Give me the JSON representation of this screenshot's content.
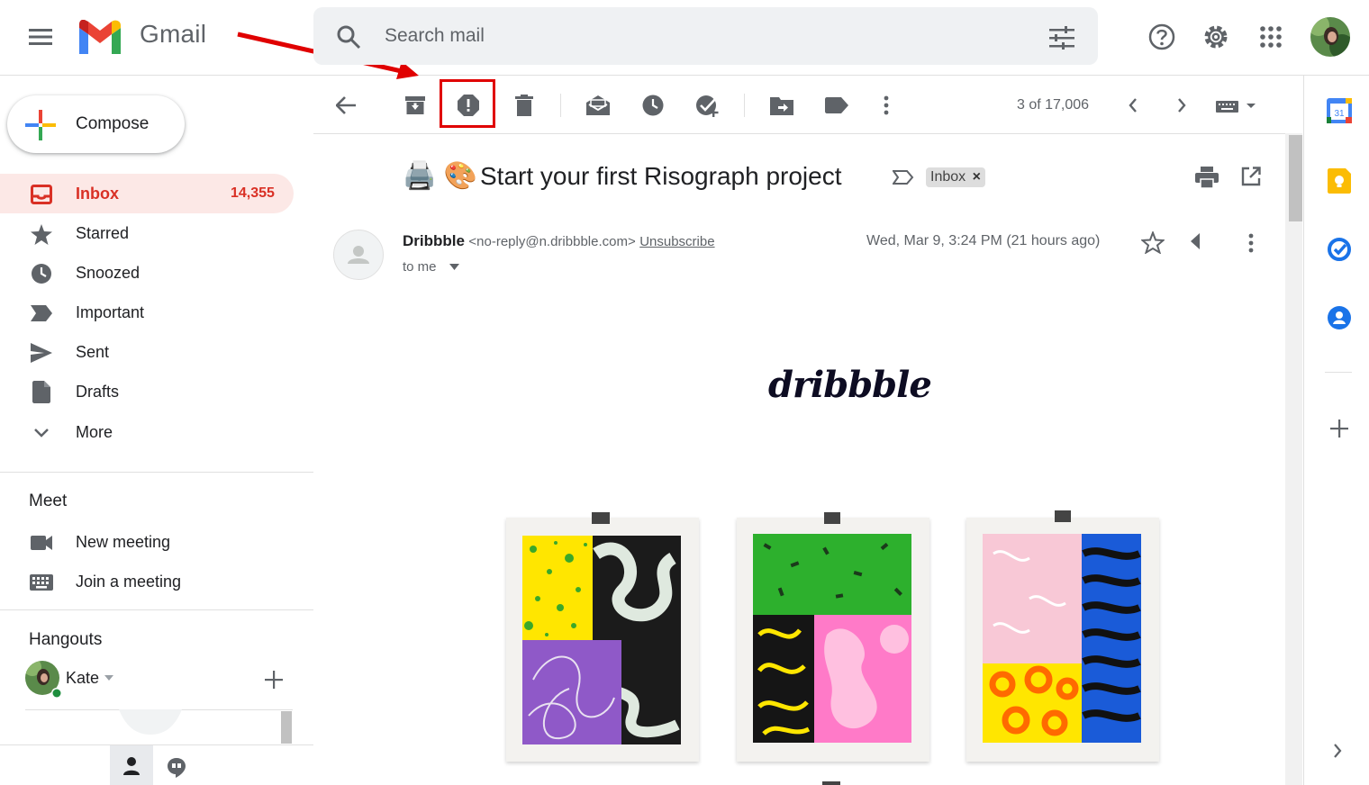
{
  "header": {
    "app_name": "Gmail",
    "search_placeholder": "Search mail"
  },
  "sidebar": {
    "compose_label": "Compose",
    "items": [
      {
        "label": "Inbox",
        "count": "14,355",
        "icon": "inbox-icon",
        "active": true
      },
      {
        "label": "Starred",
        "icon": "star-icon"
      },
      {
        "label": "Snoozed",
        "icon": "clock-icon"
      },
      {
        "label": "Important",
        "icon": "important-icon"
      },
      {
        "label": "Sent",
        "icon": "send-icon"
      },
      {
        "label": "Drafts",
        "icon": "draft-icon"
      },
      {
        "label": "More",
        "icon": "chevron-down-icon"
      }
    ],
    "meet": {
      "title": "Meet",
      "items": [
        {
          "label": "New meeting",
          "icon": "video-icon"
        },
        {
          "label": "Join a meeting",
          "icon": "keyboard-icon"
        }
      ]
    },
    "hangouts": {
      "title": "Hangouts",
      "user": "Kate"
    }
  },
  "toolbar": {
    "pager": "3 of 17,006",
    "highlighted_action": "report-spam-button"
  },
  "email": {
    "subject_emoji": "🖨️ 🎨",
    "subject": "Start your first Risograph project",
    "label_chip": "Inbox",
    "sender_name": "Dribbble",
    "sender_email": "<no-reply@n.dribbble.com>",
    "unsubscribe": "Unsubscribe",
    "date": "Wed, Mar 9, 3:24 PM (21 hours ago)",
    "recipient": "to me",
    "brand_logo": "dribbble"
  },
  "colors": {
    "accent_red": "#d93025",
    "highlight_box": "#e00000",
    "active_bg": "#fce8e6"
  }
}
